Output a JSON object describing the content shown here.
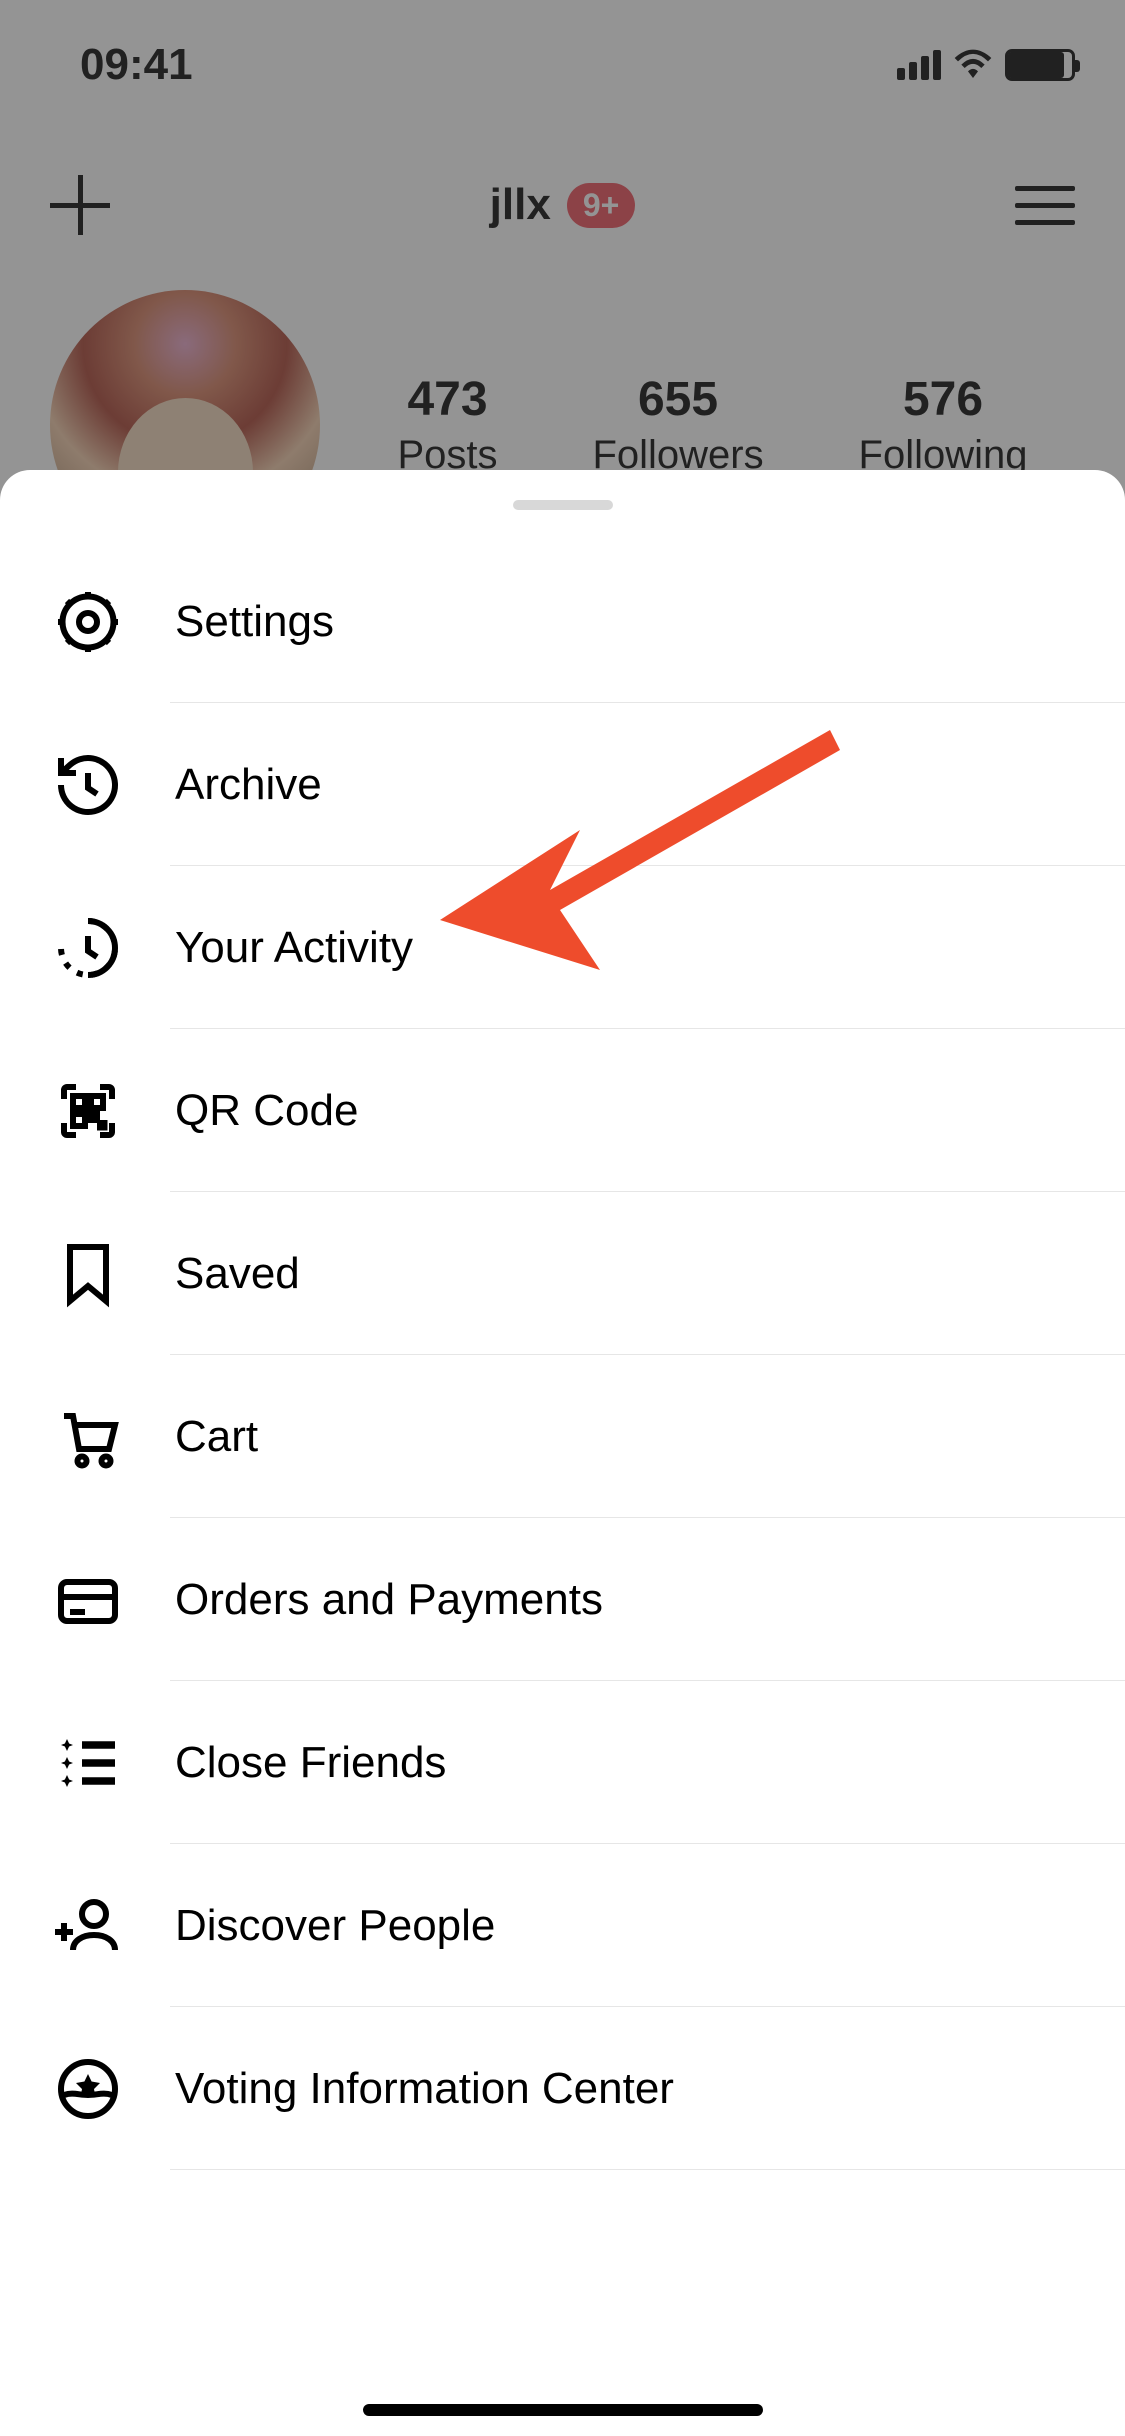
{
  "status": {
    "time": "09:41"
  },
  "header": {
    "username": "jllx",
    "badge": "9+"
  },
  "profile": {
    "stats": [
      {
        "count": "473",
        "label": "Posts"
      },
      {
        "count": "655",
        "label": "Followers"
      },
      {
        "count": "576",
        "label": "Following"
      }
    ]
  },
  "menu": [
    {
      "icon": "gear-icon",
      "label": "Settings"
    },
    {
      "icon": "archive-icon",
      "label": "Archive"
    },
    {
      "icon": "activity-icon",
      "label": "Your Activity"
    },
    {
      "icon": "qr-icon",
      "label": "QR Code"
    },
    {
      "icon": "bookmark-icon",
      "label": "Saved"
    },
    {
      "icon": "cart-icon",
      "label": "Cart"
    },
    {
      "icon": "card-icon",
      "label": "Orders and Payments"
    },
    {
      "icon": "close-friends-icon",
      "label": "Close Friends"
    },
    {
      "icon": "discover-icon",
      "label": "Discover People"
    },
    {
      "icon": "vote-icon",
      "label": "Voting Information Center"
    }
  ],
  "annotation": {
    "target": "Your Activity",
    "color": "#ee4c2c"
  }
}
